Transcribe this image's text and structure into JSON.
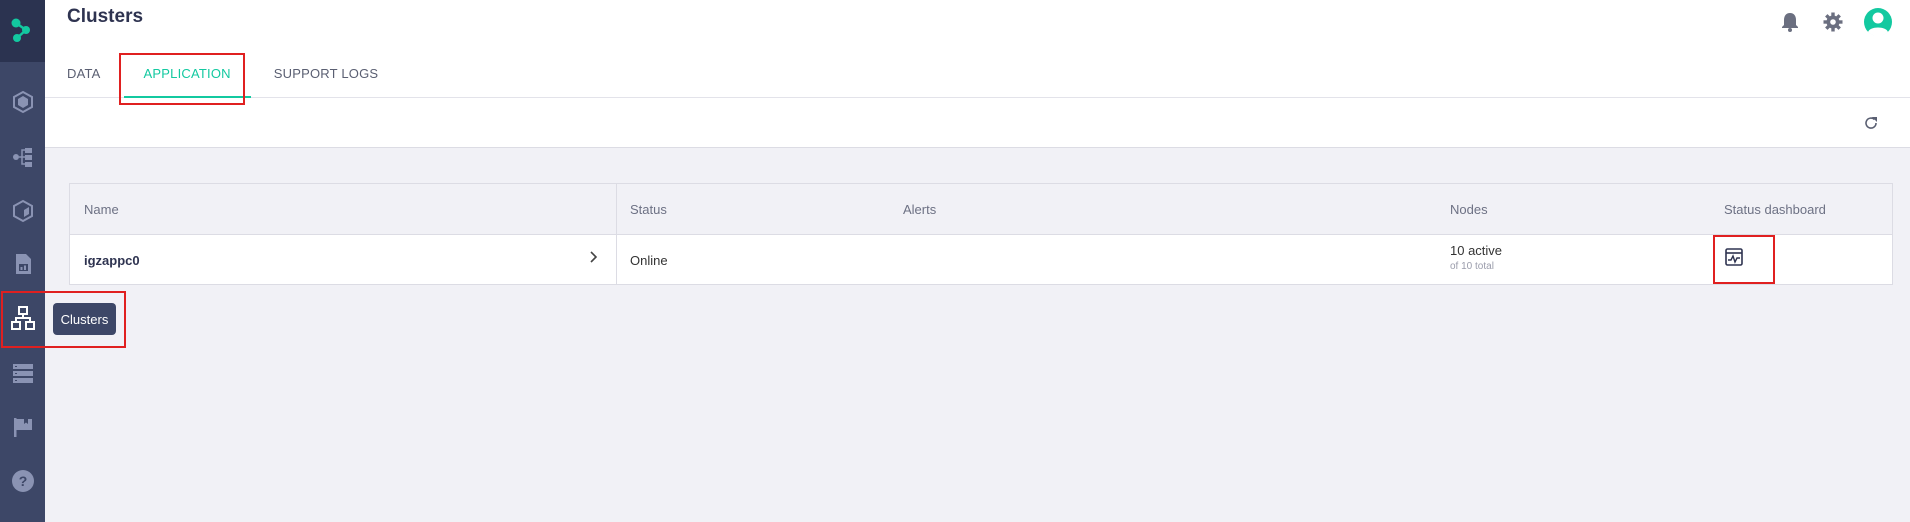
{
  "header": {
    "title": "Clusters",
    "tabs": [
      {
        "label": "DATA"
      },
      {
        "label": "APPLICATION",
        "active": true
      },
      {
        "label": "SUPPORT LOGS"
      }
    ],
    "icons": [
      "bell-icon",
      "gear-icon",
      "user-avatar-icon"
    ]
  },
  "sidebar": {
    "items": [
      {
        "icon": "logo-icon"
      },
      {
        "icon": "hexagon-icon"
      },
      {
        "icon": "pipelines-icon"
      },
      {
        "icon": "cube-icon"
      },
      {
        "icon": "report-icon"
      },
      {
        "icon": "clusters-icon",
        "tooltip": "Clusters"
      },
      {
        "icon": "list-icon"
      },
      {
        "icon": "flag-icon"
      },
      {
        "icon": "help-icon"
      }
    ],
    "tooltip": "Clusters"
  },
  "toolbar": {
    "refresh_icon": "refresh-icon"
  },
  "table": {
    "columns": [
      "Name",
      "Status",
      "Alerts",
      "Nodes",
      "Status dashboard"
    ],
    "rows": [
      {
        "name": "igzappc0",
        "status": "Online",
        "alerts": "",
        "nodes_active": "10 active",
        "nodes_total": "of 10 total",
        "dashboard_icon": "dashboard-icon"
      }
    ]
  },
  "colors": {
    "accent": "#13c9a0",
    "sidebar": "#3d4767",
    "highlight": "#e02020"
  }
}
